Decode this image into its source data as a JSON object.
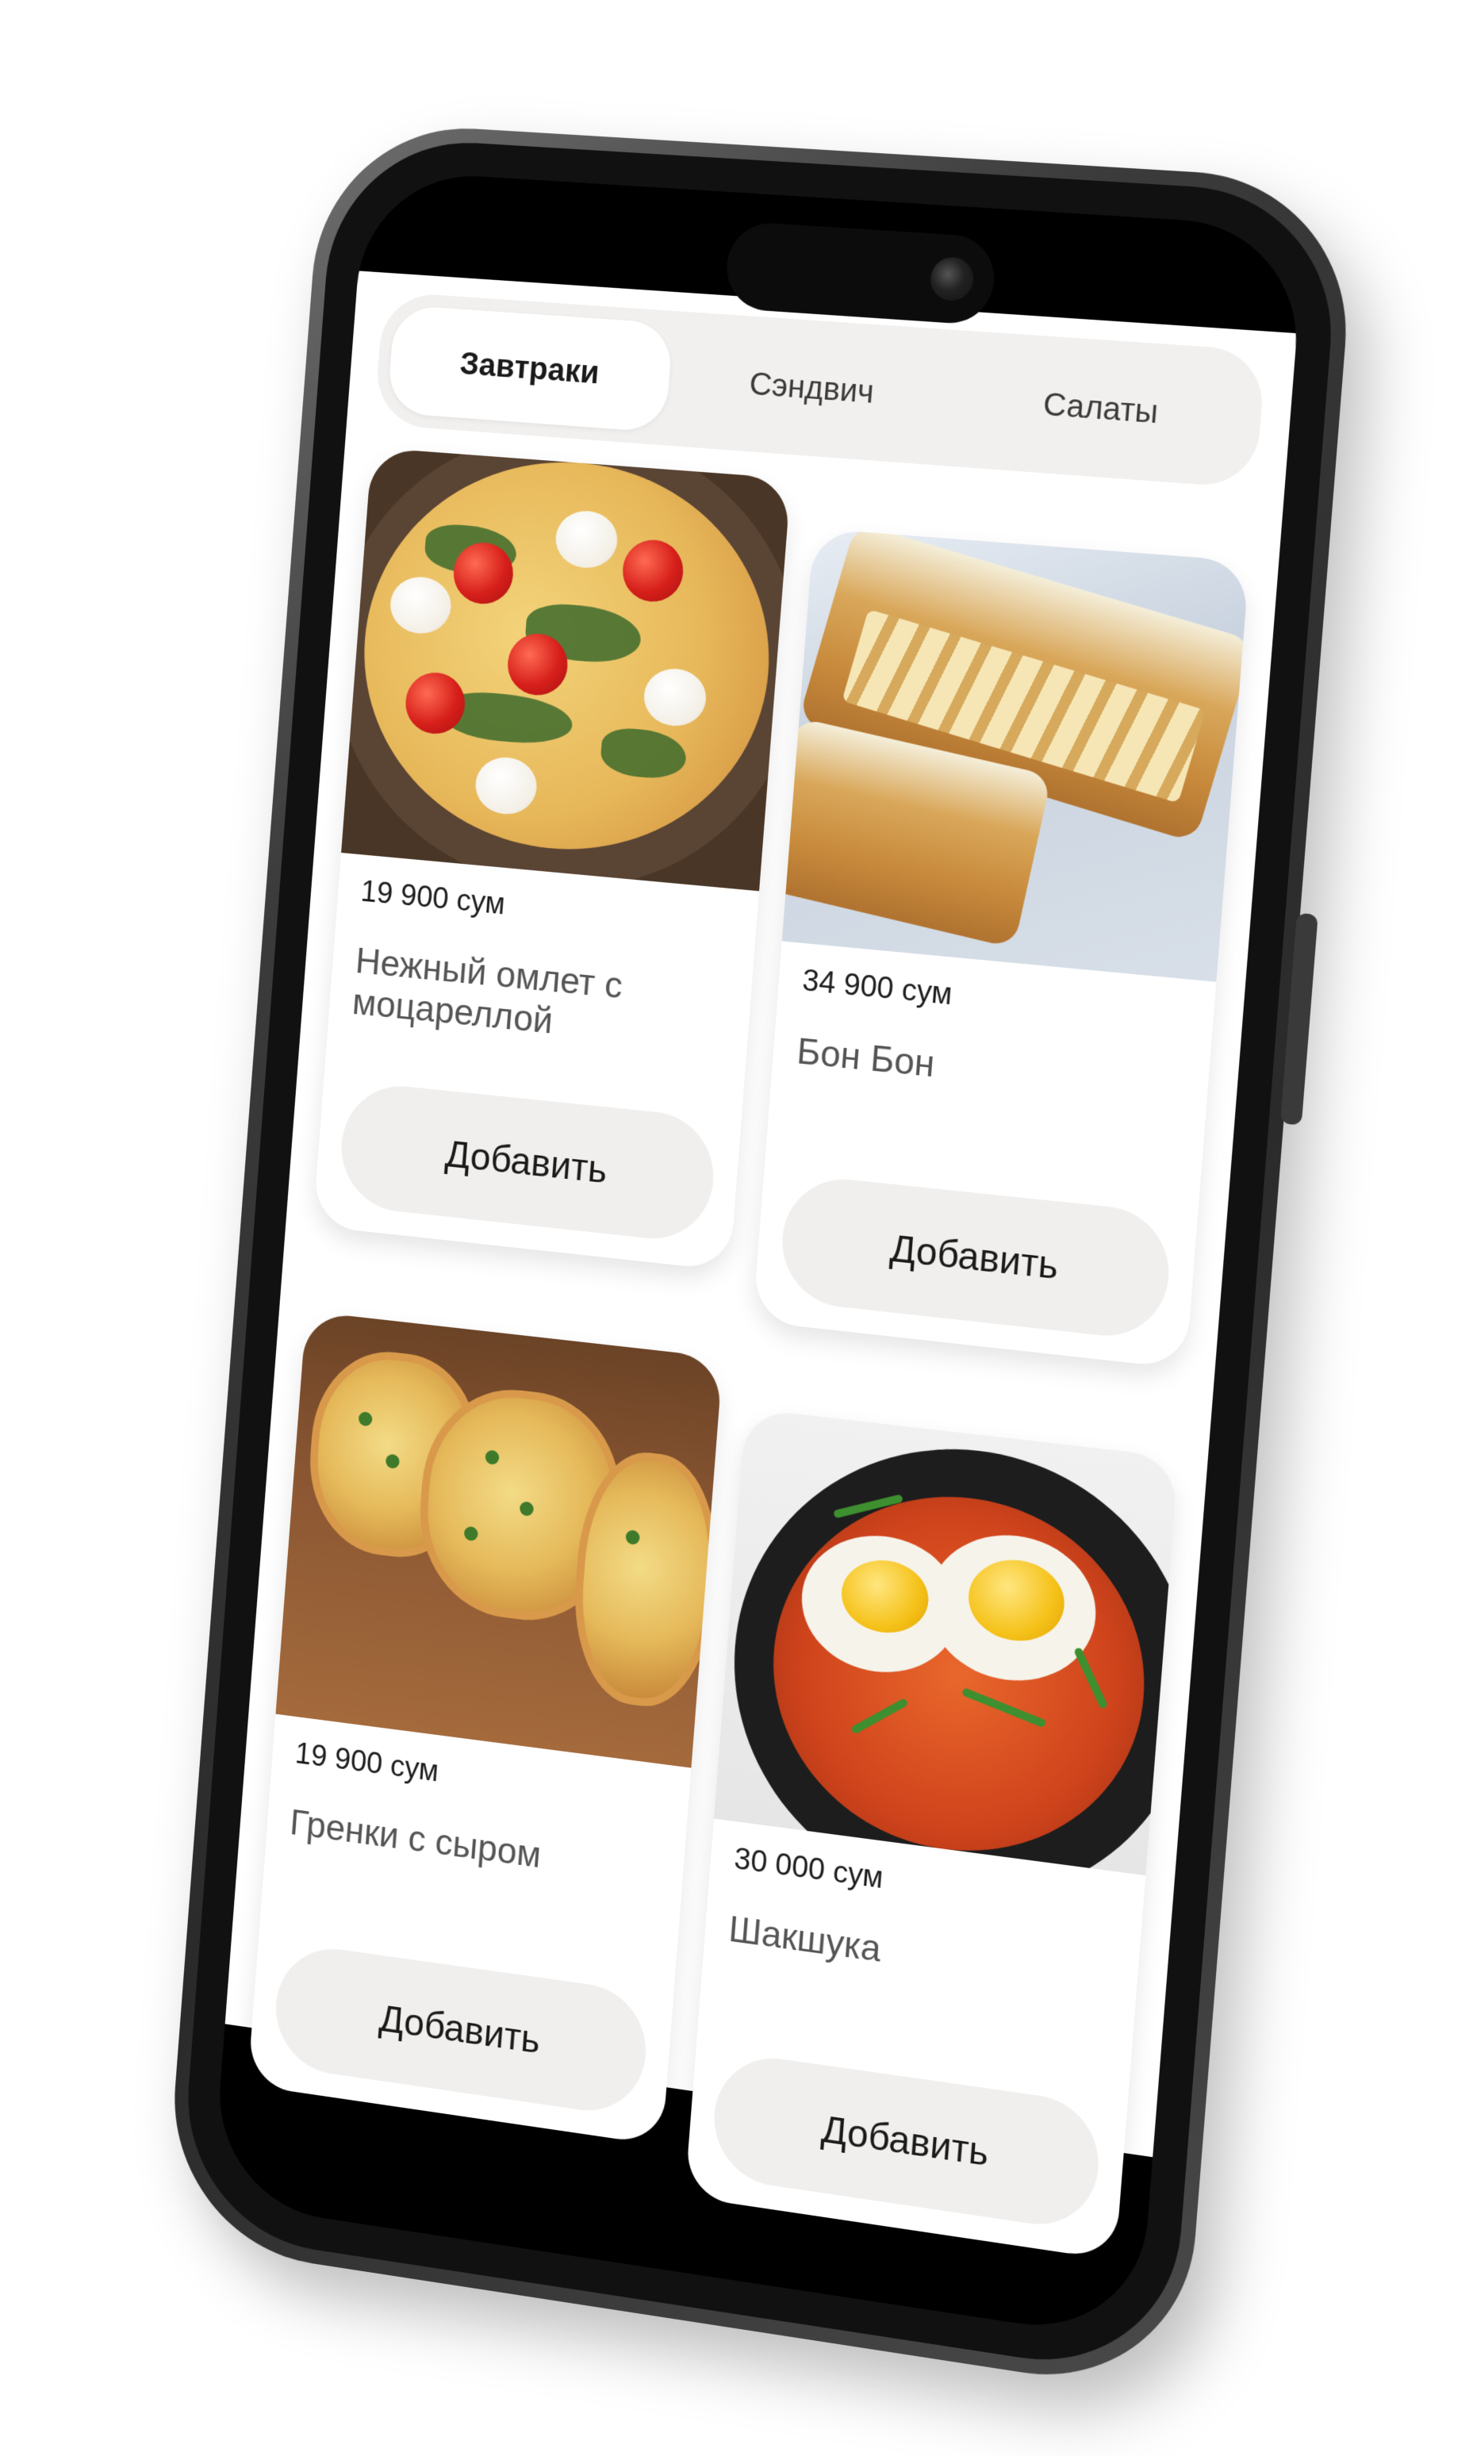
{
  "tabs": [
    {
      "label": "Завтраки",
      "active": true
    },
    {
      "label": "Сэндвич",
      "active": false
    },
    {
      "label": "Салаты",
      "active": false
    }
  ],
  "products": [
    {
      "price": "19 900 сум",
      "name": "Нежный омлет с моцареллой",
      "button": "Добавить"
    },
    {
      "price": "34 900 сум",
      "name": "Бон Бон",
      "button": "Добавить"
    },
    {
      "price": "19 900 сум",
      "name": "Гренки с сыром",
      "button": "Добавить"
    },
    {
      "price": "30 000 сум",
      "name": "Шакшука",
      "button": "Добавить"
    }
  ],
  "colors": {
    "phone_frame": "#2a2a2a",
    "tab_bar_bg": "#f2f0ee",
    "button_bg": "#f1efed",
    "card_bg": "#ffffff"
  }
}
